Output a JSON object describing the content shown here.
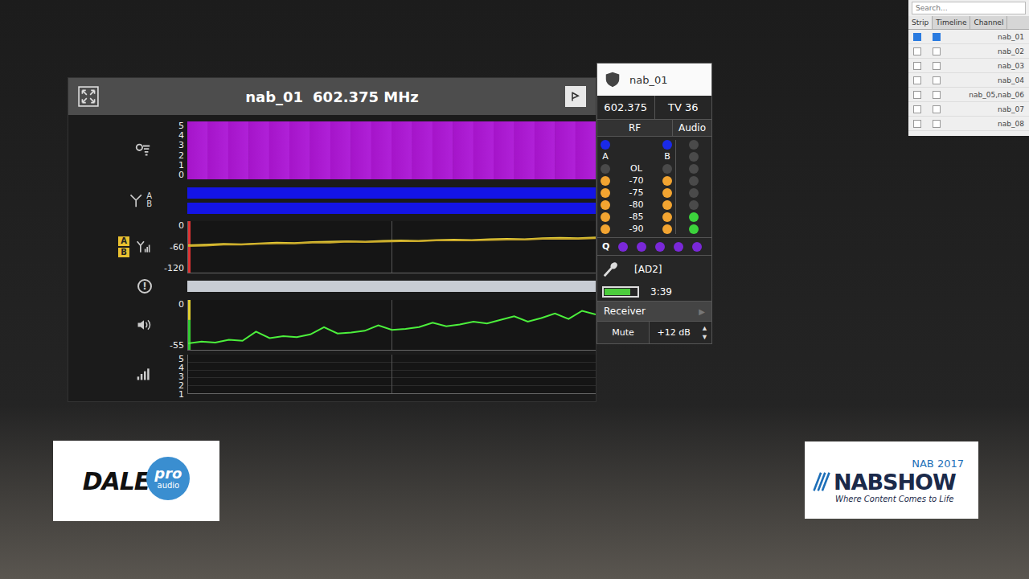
{
  "window": {
    "title": "nab_01",
    "frequency": "602.375 MHz"
  },
  "quality_chart": {
    "ticks": [
      "5",
      "4",
      "3",
      "2",
      "1",
      "0"
    ],
    "max": 5,
    "values": [
      5,
      5,
      5,
      5,
      5,
      5,
      5,
      5,
      5,
      5,
      5,
      5,
      5,
      5,
      5,
      5,
      5,
      5,
      5,
      5
    ]
  },
  "antenna_chart": {
    "labels": [
      "A",
      "B"
    ],
    "series": [
      {
        "label": "A",
        "level": 1
      },
      {
        "label": "B",
        "level": 1
      }
    ]
  },
  "rf_chart": {
    "ticks": [
      "0",
      "-60",
      "-120"
    ],
    "min": -120,
    "max": 0,
    "legend": [
      "A",
      "B"
    ],
    "series": [
      {
        "label": "A",
        "color": "#e8d23a",
        "values": [
          -56,
          -55,
          -53,
          -54,
          -52,
          -50,
          -51,
          -49,
          -48,
          -47,
          -48,
          -46,
          -45,
          -46,
          -44,
          -43,
          -44,
          -42,
          -41,
          -42,
          -40,
          -39,
          -40,
          -38
        ]
      },
      {
        "label": "B",
        "color": "#c9a82a",
        "values": [
          -58,
          -57,
          -55,
          -55,
          -53,
          -52,
          -52,
          -50,
          -50,
          -48,
          -49,
          -48,
          -47,
          -47,
          -45,
          -45,
          -45,
          -44,
          -43,
          -43,
          -41,
          -41,
          -41,
          -40
        ]
      }
    ]
  },
  "alert_row": {
    "icon": "!"
  },
  "audio_chart": {
    "ticks": [
      "0",
      "-55"
    ],
    "min": -55,
    "max": 0,
    "color": "#4cf03c",
    "values": [
      -48,
      -46,
      -47,
      -44,
      -45,
      -35,
      -42,
      -40,
      -41,
      -38,
      -30,
      -37,
      -36,
      -34,
      -28,
      -33,
      -32,
      -30,
      -25,
      -29,
      -27,
      -24,
      -26,
      -22,
      -18,
      -24,
      -20,
      -15,
      -21,
      -12,
      -16
    ]
  },
  "bottom_chart": {
    "ticks": [
      "5",
      "4",
      "3",
      "2",
      "1"
    ]
  },
  "channel_strip": {
    "name": "nab_01",
    "frequency": "602.375",
    "tv_channel": "TV 36",
    "rf_label": "RF",
    "audio_label": "Audio",
    "antennas": [
      {
        "label": "A",
        "active": true
      },
      {
        "label": "B",
        "active": true
      }
    ],
    "rf_scale": [
      "OL",
      "-70",
      "-75",
      "-80",
      "-85",
      "-90"
    ],
    "rf_leds_a": [
      false,
      true,
      true,
      true,
      true,
      true
    ],
    "rf_leds_b": [
      false,
      true,
      true,
      true,
      true,
      true
    ],
    "audio_leds": [
      false,
      false,
      false,
      false,
      false,
      false,
      true,
      true
    ],
    "quality_label": "Q",
    "quality_dots": [
      true,
      true,
      true,
      true,
      true
    ],
    "transmitter_model": "[AD2]",
    "battery_level": 0.8,
    "battery_time": "3:39",
    "receiver_button": "Receiver",
    "receiver_arrow": "▶",
    "mute_button": "Mute",
    "gain": "+12 dB",
    "gain_up": "▲",
    "gain_down": "▼"
  },
  "channel_list": {
    "search": {
      "placeholder": "Search..."
    },
    "tabs": [
      {
        "label": "Strip",
        "selected": true
      },
      {
        "label": "Timeline",
        "selected": false
      },
      {
        "label": "Channel",
        "selected": false
      }
    ],
    "rows": [
      {
        "name": "nab_01",
        "strip": true,
        "timeline": true
      },
      {
        "name": "nab_02",
        "strip": false,
        "timeline": false
      },
      {
        "name": "nab_03",
        "strip": false,
        "timeline": false
      },
      {
        "name": "nab_04",
        "strip": false,
        "timeline": false
      },
      {
        "name": "nab_05,nab_06",
        "strip": false,
        "timeline": false
      },
      {
        "name": "nab_07",
        "strip": false,
        "timeline": false
      },
      {
        "name": "nab_08",
        "strip": false,
        "timeline": false
      }
    ]
  },
  "dale_logo": {
    "word": "DALE",
    "badge": "pro",
    "sub": "audio"
  },
  "nab_logo": {
    "year": "NAB 2017",
    "name": "NABSHOW",
    "tagline": "Where Content Comes to Life"
  }
}
